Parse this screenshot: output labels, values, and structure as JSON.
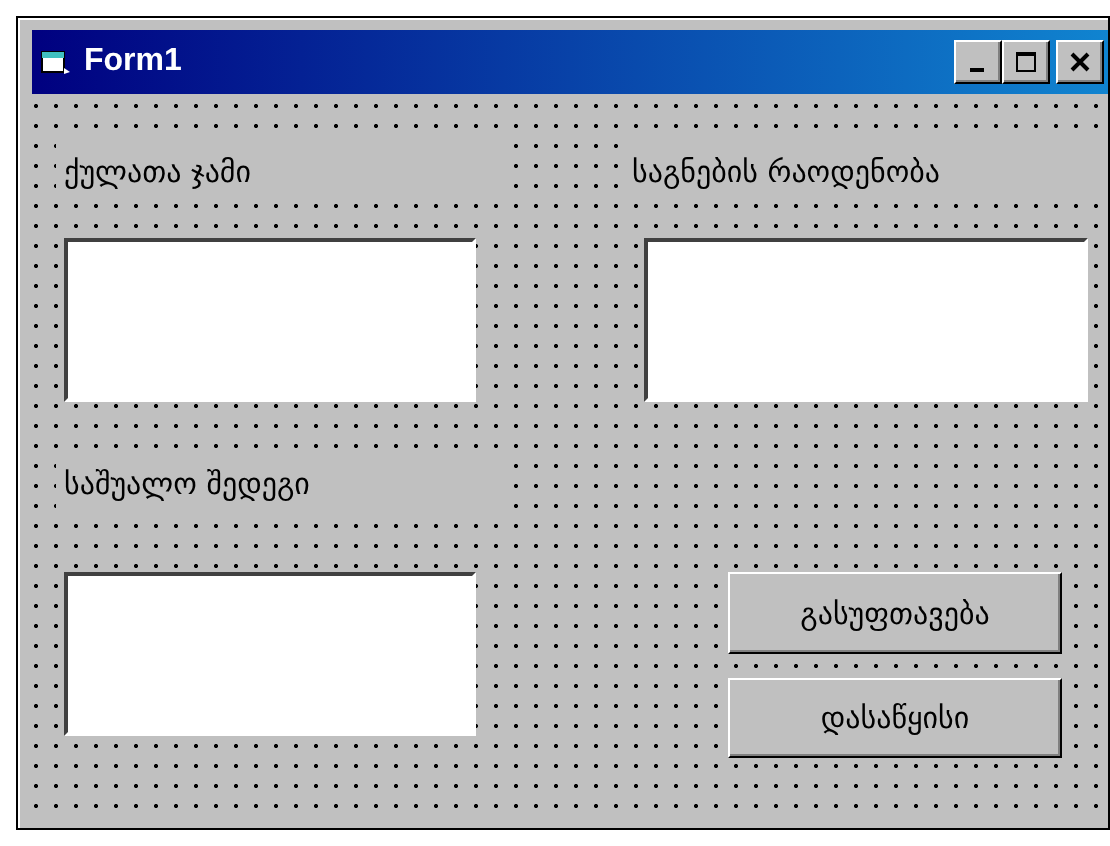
{
  "window": {
    "title": "Form1"
  },
  "controls": [
    {
      "kind": "label",
      "text": "ქულათა ჯამი"
    },
    {
      "kind": "label",
      "text": "საგნების რაოდენობა"
    },
    {
      "kind": "textbox"
    },
    {
      "kind": "textbox"
    },
    {
      "kind": "label",
      "text": "საშუალო შედეგი"
    },
    {
      "kind": "textbox"
    },
    {
      "kind": "button",
      "text": "გასუფთავება"
    },
    {
      "kind": "button",
      "text": "დასაწყისი"
    }
  ]
}
